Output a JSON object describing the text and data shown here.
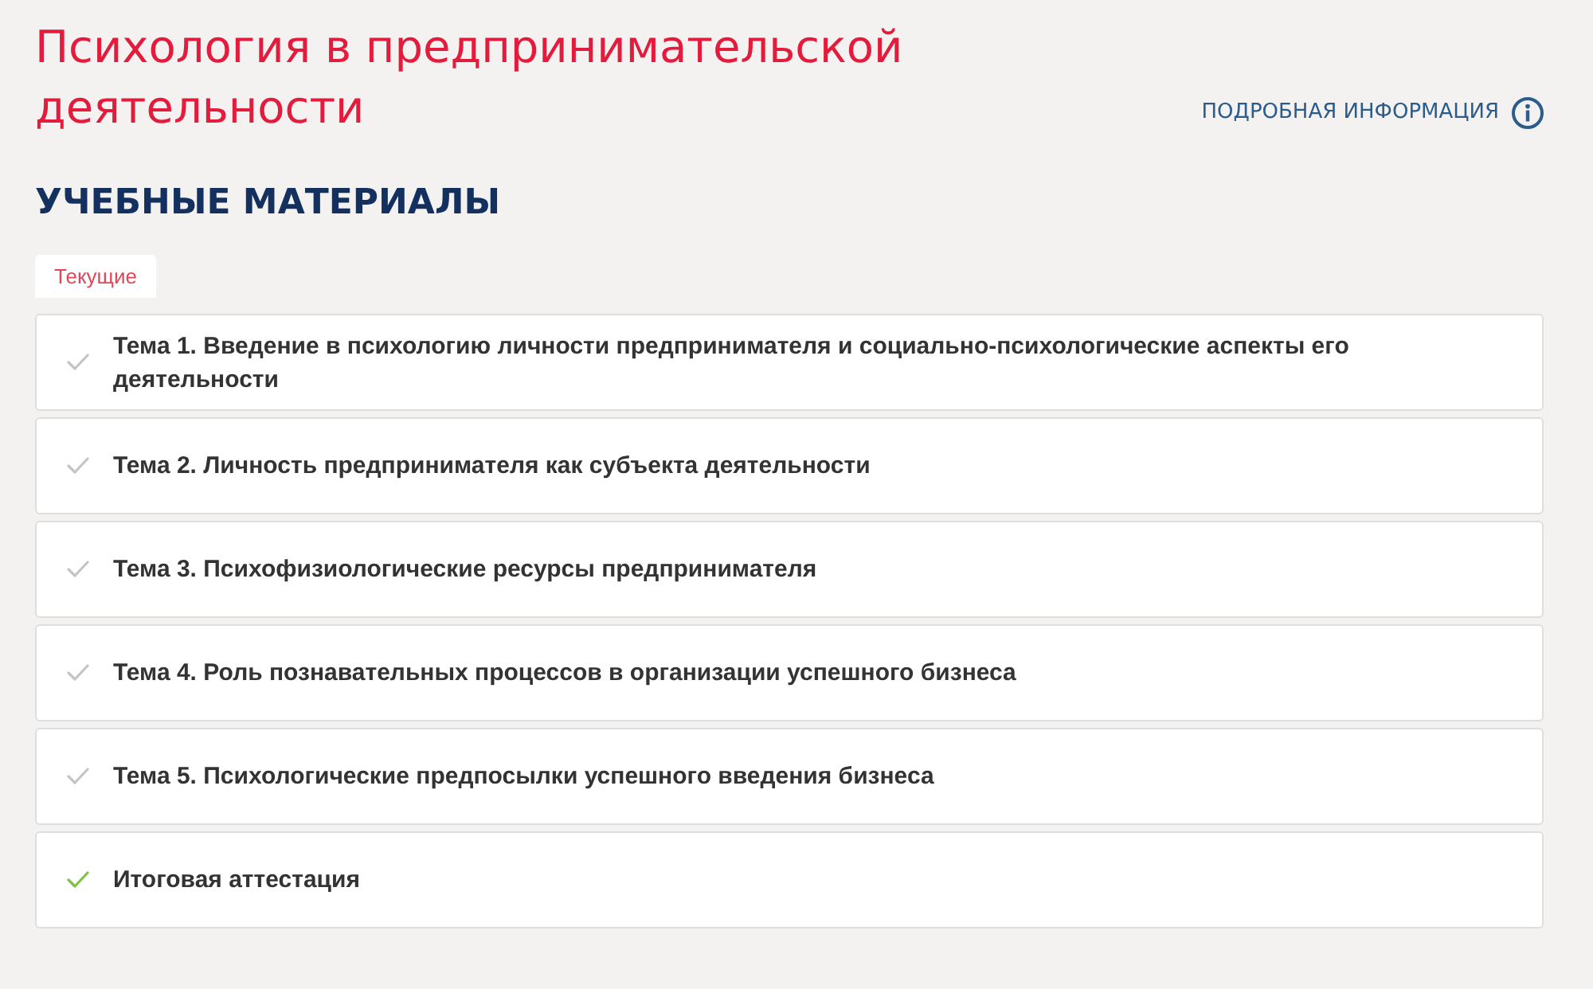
{
  "course": {
    "title": "Психология в предпринимательской деятельности"
  },
  "info_link": {
    "label": "ПОДРОБНАЯ ИНФОРМАЦИЯ"
  },
  "section": {
    "heading": "УЧЕБНЫЕ МАТЕРИАЛЫ"
  },
  "tabs": [
    {
      "label": "Текущие",
      "selected": true
    }
  ],
  "topics": [
    {
      "title": "Тема 1. Введение в психологию личности предпринимателя и социально-психологические аспекты его деятельности",
      "completed": false
    },
    {
      "title": "Тема 2. Личность предпринимателя как субъекта деятельности",
      "completed": false
    },
    {
      "title": "Тема 3. Психофизиологические ресурсы предпринимателя",
      "completed": false
    },
    {
      "title": "Тема 4. Роль познавательных процессов в организации успешного бизнеса",
      "completed": false
    },
    {
      "title": "Тема 5. Психологические предпосылки успешного введения бизнеса",
      "completed": false
    },
    {
      "title": "Итоговая аттестация",
      "completed": true
    }
  ]
}
